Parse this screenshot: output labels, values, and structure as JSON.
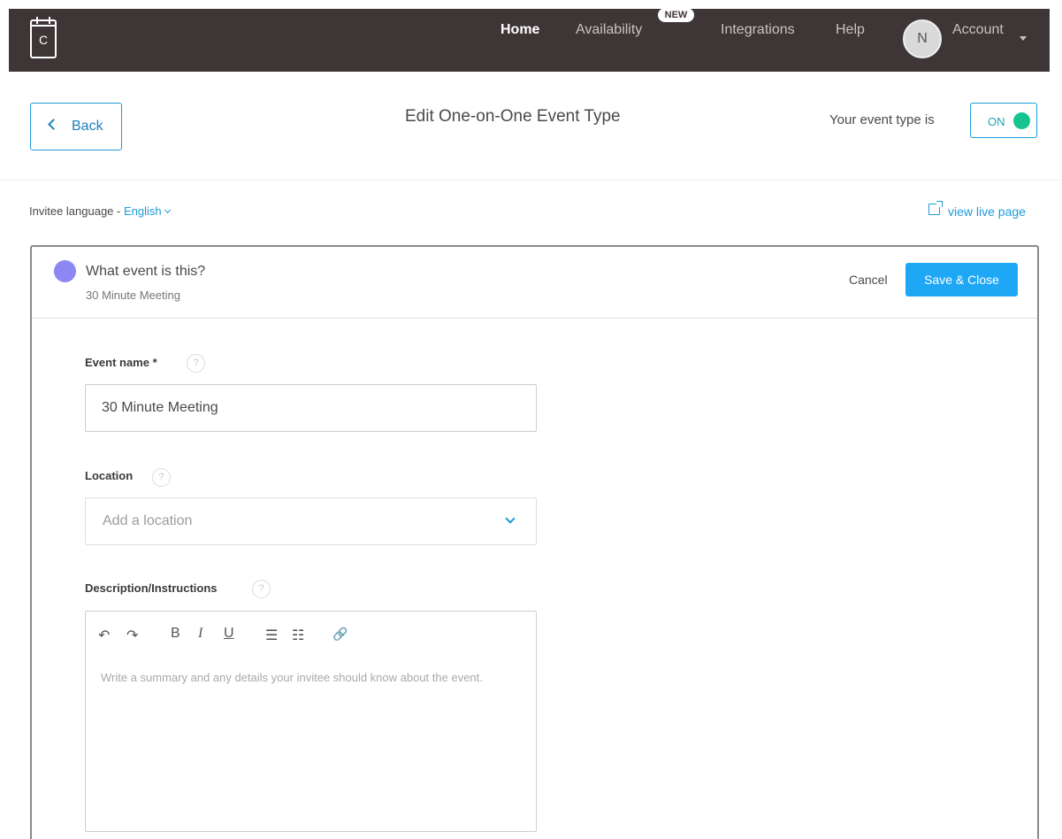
{
  "nav": {
    "logo_letter": "C",
    "items": [
      {
        "label": "Home",
        "active": true
      },
      {
        "label": "Availability",
        "badge": "NEW"
      },
      {
        "label": "Integrations"
      },
      {
        "label": "Help"
      }
    ],
    "avatar_initial": "N",
    "account_label": "Account"
  },
  "header": {
    "back_label": "Back",
    "title": "Edit One-on-One Event Type",
    "status_text": "Your event type is",
    "toggle_label": "ON"
  },
  "subheader": {
    "language_prefix": "Invitee language - ",
    "language_value": "English",
    "live_link": "view live page"
  },
  "card": {
    "question": "What event is this?",
    "subtitle": "30 Minute Meeting",
    "cancel_label": "Cancel",
    "save_label": "Save & Close",
    "event_name_label": "Event name *",
    "event_name_value": "30 Minute Meeting",
    "location_label": "Location",
    "location_placeholder": "Add a location",
    "description_label": "Description/Instructions",
    "description_placeholder": "Write a summary and any details your invitee should know about the event.",
    "help_glyph": "?",
    "toolbar": {
      "undo": "↶",
      "redo": "↷",
      "bold": "B",
      "italic": "I",
      "underline": "U",
      "bullets": "☰",
      "numbered": "☷",
      "link": "🔗"
    }
  },
  "colors": {
    "nav_bg": "#3e3536",
    "accent": "#1ea7f5",
    "toggle_on": "#16c391",
    "event_color": "#8c87f4"
  }
}
